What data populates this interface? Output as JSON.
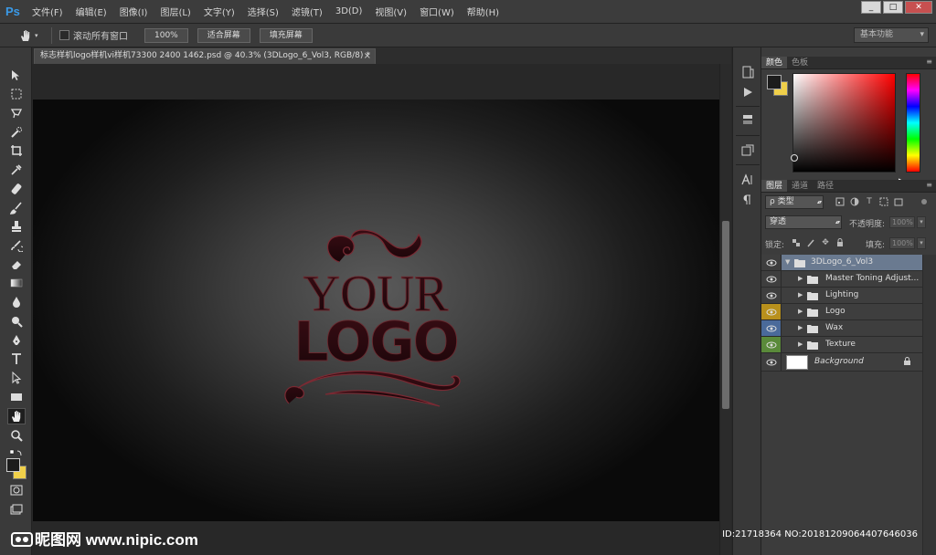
{
  "app": {
    "logo": "Ps",
    "menu": [
      "文件(F)",
      "编辑(E)",
      "图像(I)",
      "图层(L)",
      "文字(Y)",
      "选择(S)",
      "滤镜(T)",
      "3D(D)",
      "视图(V)",
      "窗口(W)",
      "帮助(H)"
    ],
    "window_controls": {
      "minimize": "_",
      "restore": "□",
      "close": "✕"
    }
  },
  "options_bar": {
    "scroll_all_label": "滚动所有窗口",
    "zoom_100": "100%",
    "fit_screen": "适合屏幕",
    "fill_screen": "填充屏幕",
    "workspace": "基本功能"
  },
  "document": {
    "tab_title": "标志样机logo样机vi样机73300 2400 1462.psd @ 40.3% (3DLogo_6_Vol3, RGB/8) *",
    "close_glyph": "×",
    "logo_line1": "YOUR",
    "logo_line2": "LOGO"
  },
  "color_panel": {
    "tabs": [
      "颜色",
      "色板"
    ],
    "foreground": "#1c1c1c",
    "background": "#f0d04a"
  },
  "layers_panel": {
    "tabs": [
      "图层",
      "通道",
      "路径"
    ],
    "filter_kind": "ρ 类型",
    "blend_mode": "穿透",
    "opacity_label": "不透明度:",
    "opacity_value": "100%",
    "lock_label": "锁定:",
    "fill_label": "填充:",
    "fill_value": "100%",
    "layers": [
      {
        "name": "3DLogo_6_Vol3",
        "type": "group",
        "expanded": true,
        "selected": true,
        "eye_color": "#3e3e3e"
      },
      {
        "name": "Master Toning Adjust...",
        "type": "group",
        "expanded": false,
        "eye_color": "#3e3e3e"
      },
      {
        "name": "Lighting",
        "type": "group",
        "expanded": false,
        "eye_color": "#3e3e3e"
      },
      {
        "name": "Logo",
        "type": "group",
        "expanded": false,
        "eye_color": "#b8901c"
      },
      {
        "name": "Wax",
        "type": "group",
        "expanded": false,
        "eye_color": "#4a6a9a"
      },
      {
        "name": "Texture",
        "type": "group",
        "expanded": false,
        "eye_color": "#5a8a3a"
      },
      {
        "name": "Background",
        "type": "background",
        "locked": true,
        "eye_color": "#3e3e3e"
      }
    ]
  },
  "watermark": {
    "brand": "昵图网 www.nipic.com",
    "id_text": "ID:21718364 NO:20181209064407646036"
  }
}
